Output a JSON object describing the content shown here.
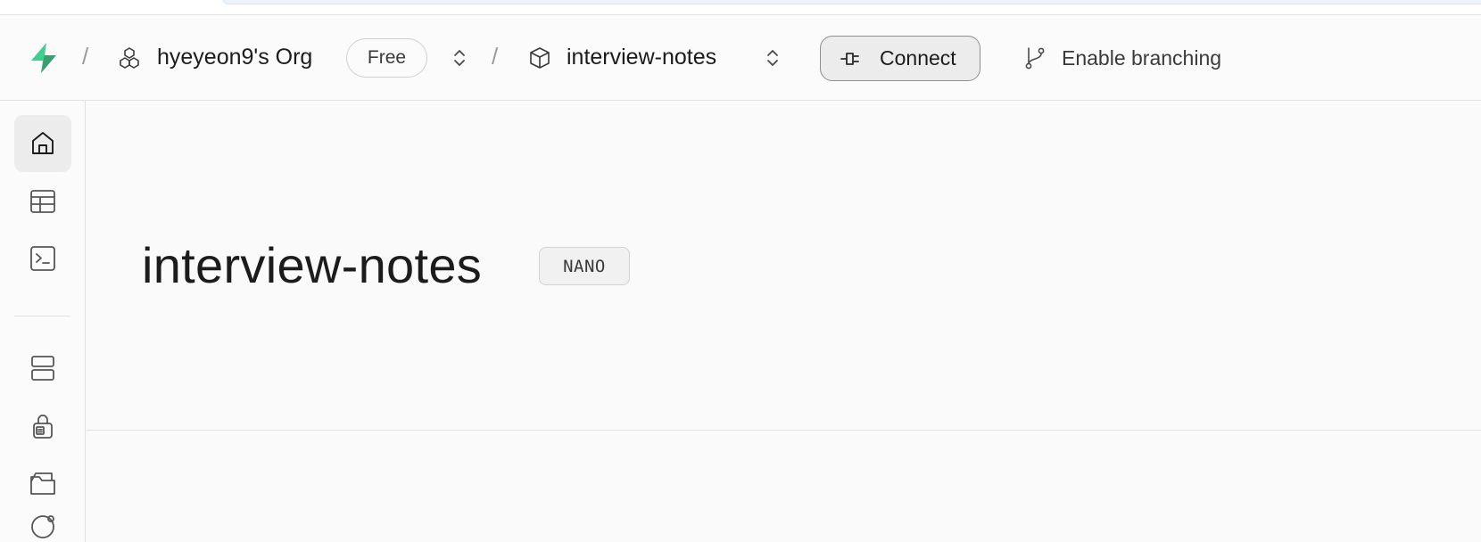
{
  "topbar": {
    "org": {
      "name": "hyeyeon9's Org",
      "plan": "Free"
    },
    "project": {
      "name": "interview-notes"
    },
    "connect_label": "Connect",
    "branching_label": "Enable branching",
    "separator": "/"
  },
  "sidebar": {
    "items": [
      {
        "icon": "home-icon",
        "active": true
      },
      {
        "icon": "table-editor-icon",
        "active": false
      },
      {
        "icon": "sql-editor-icon",
        "active": false
      },
      {
        "icon": "database-icon",
        "active": false
      },
      {
        "icon": "authentication-icon",
        "active": false
      },
      {
        "icon": "storage-icon",
        "active": false
      },
      {
        "icon": "realtime-icon",
        "active": false
      }
    ]
  },
  "main": {
    "project_title": "interview-notes",
    "compute_badge": "NANO"
  },
  "colors": {
    "brand_green": "#3ecf8e",
    "brand_green_dark": "#249361",
    "active_bg": "#ececec",
    "border": "#e2e2e2"
  }
}
